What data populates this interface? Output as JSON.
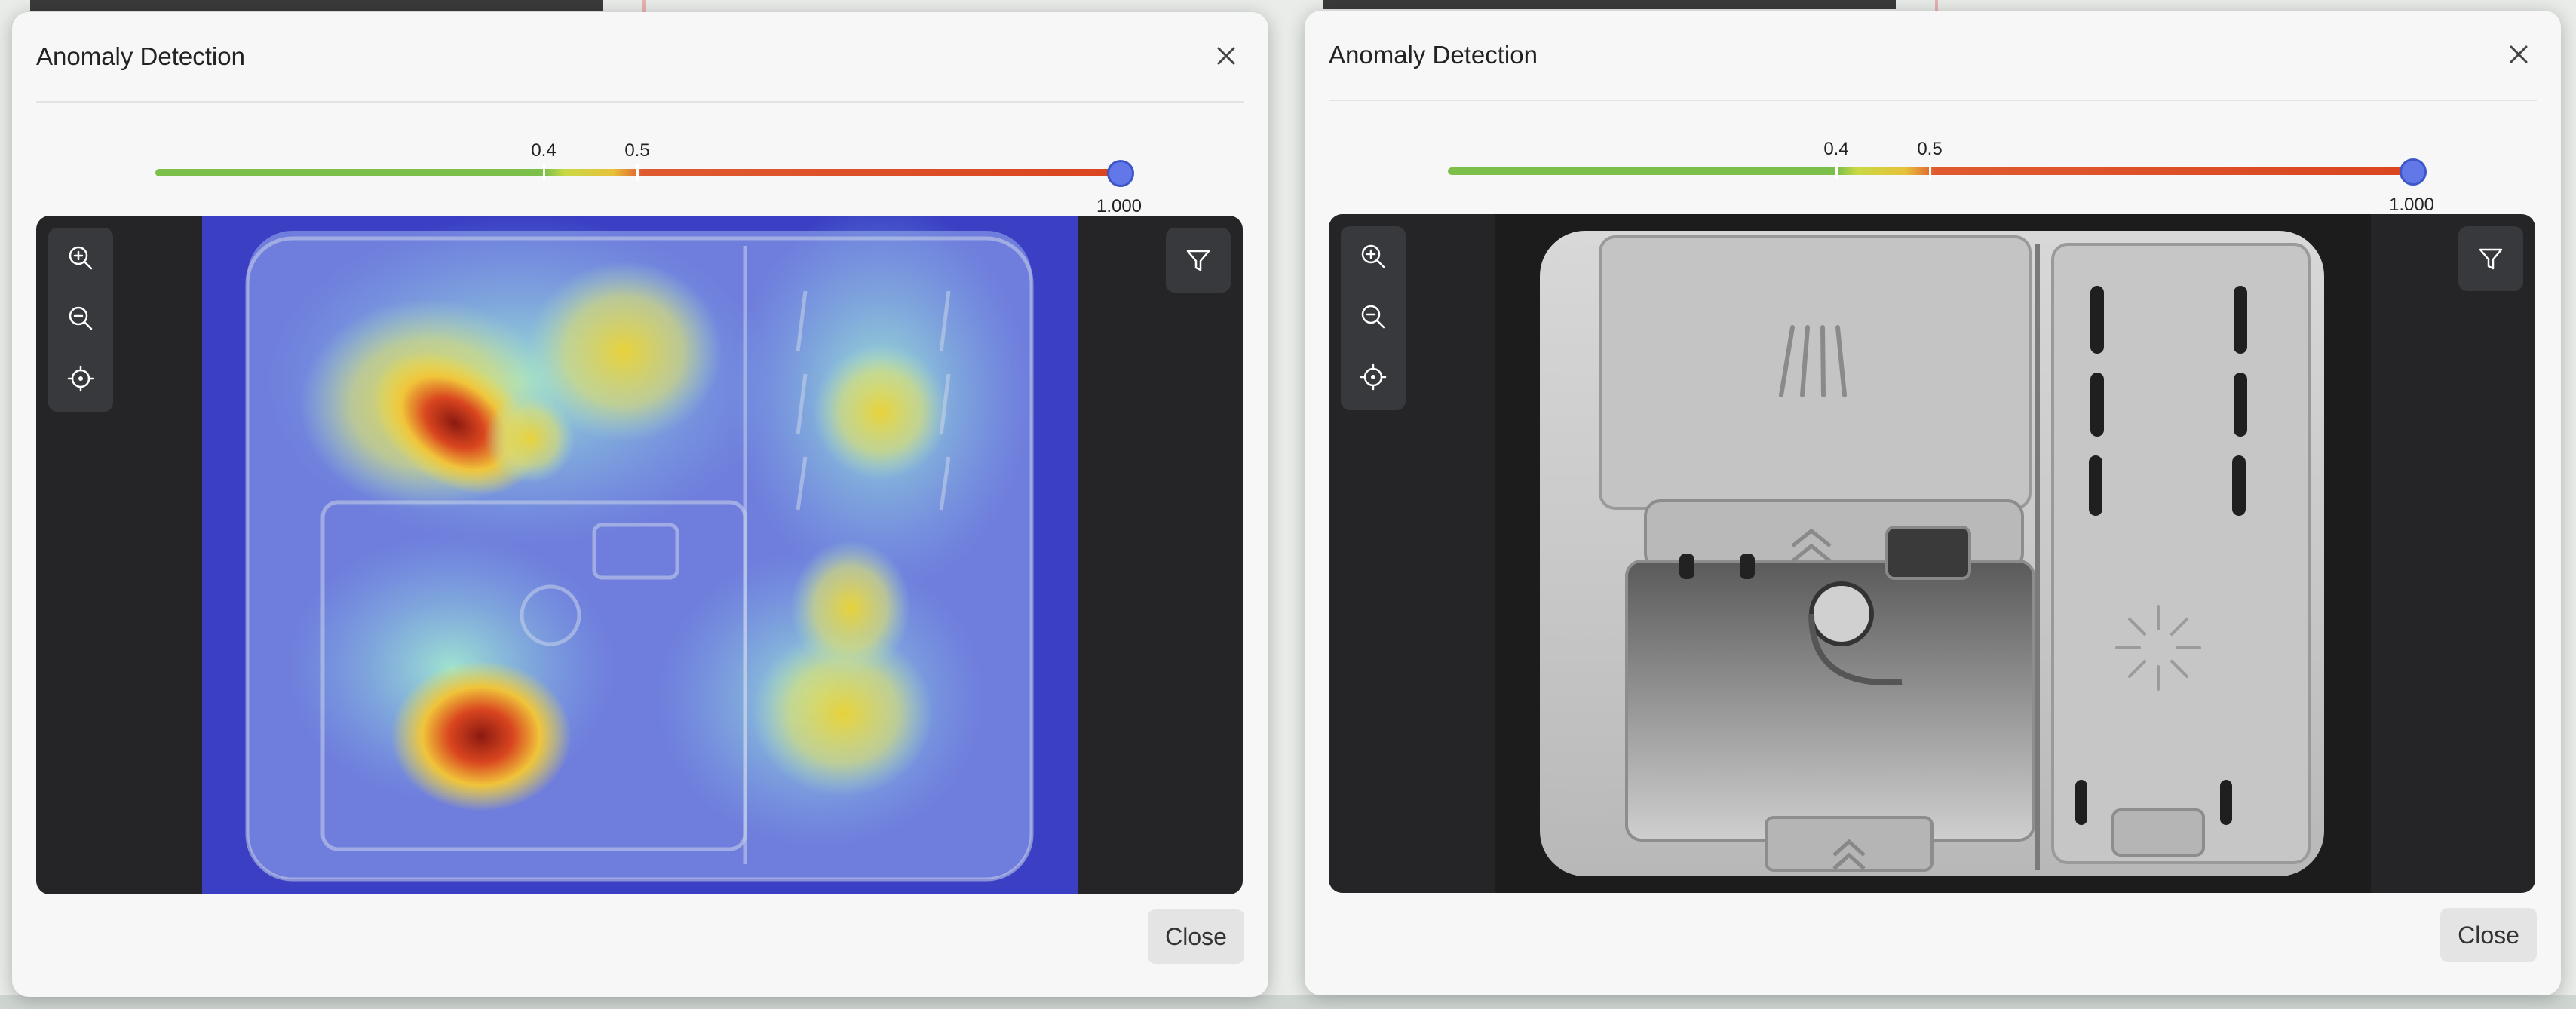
{
  "panels": [
    {
      "title": "Anomaly Detection",
      "view": "heatmap",
      "threshold_low_label": "0.4",
      "threshold_high_label": "0.5",
      "threshold_low": 0.4,
      "threshold_high": 0.5,
      "slider_value": "1.000",
      "close_label": "Close"
    },
    {
      "title": "Anomaly Detection",
      "view": "original",
      "threshold_low_label": "0.4",
      "threshold_high_label": "0.5",
      "threshold_low": 0.4,
      "threshold_high": 0.5,
      "slider_value": "1.000",
      "close_label": "Close"
    }
  ],
  "icons": {
    "zoom_in": "zoom-in-icon",
    "zoom_out": "zoom-out-icon",
    "recenter": "crosshair-icon",
    "filter": "filter-icon",
    "close": "close-icon"
  },
  "colors": {
    "normal": "#7cc04a",
    "anomaly": "#d9451f",
    "handle": "#6278e8"
  }
}
